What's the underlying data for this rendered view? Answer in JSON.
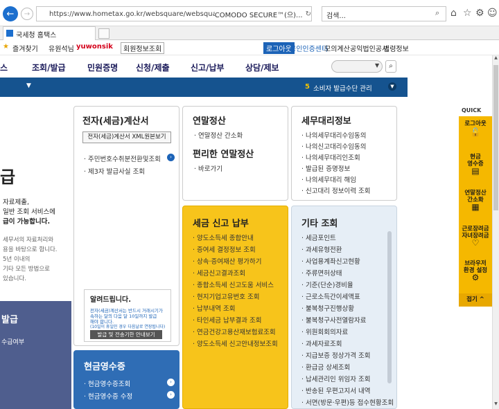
{
  "browser": {
    "url": "https://www.hometax.go.kr/websquare/websquare.wq?w2xPatl",
    "security": "COMODO SECURE™(으)...",
    "search_placeholder": "검색...",
    "tab_title": "국세청 홈택스"
  },
  "favbar": {
    "favorites": "즐겨찾기",
    "tab": "유원석님",
    "user": "yuwonsik",
    "member": "회원정보조회",
    "logout": "로그아웃",
    "cert": "공인인증센터",
    "links": [
      "모의계산",
      "공익법인공시",
      "법령정보"
    ]
  },
  "nav": {
    "items": [
      "스",
      "조회/발급",
      "민원증명",
      "신청/제출",
      "신고/납부",
      "상담/제보"
    ]
  },
  "banner": {
    "num": "5",
    "text": "소비자 발급수단 관리"
  },
  "left": {
    "big": "급",
    "lines": [
      "자료제출,",
      "일반 조회 서비스에",
      "급이 가능합니다.",
      "세무서의 자료처리와",
      "용을 바탕으로 합니다.",
      "5년 이내의",
      "기타 모든 방법으로",
      "있습니다."
    ],
    "dark_title": "발급",
    "dark_sub": "수급여부"
  },
  "card1": {
    "title": "전자(세금)계산서",
    "button": "전자(세금)계산서 XML원본보기",
    "items": [
      "주민번호수취분전환및조회",
      "제3자 발급사실 조회"
    ],
    "notice_title": "알려드립니다.",
    "notice_text": [
      "전자(세금)계산서는 반드시 거래시기가",
      "속하는 달의 다음 달 10일까지 발급",
      "해야 합니다.",
      "(10일이 휴일인 경우 다음날로 연장됩니다)"
    ],
    "notice_btn": "발급 및 전송기한 안내보기"
  },
  "card2": {
    "title": "연말정산",
    "items": [
      "연말정산 간소화"
    ],
    "title2": "편리한 연말정산",
    "items2": [
      "바로가기"
    ]
  },
  "card3": {
    "title": "세무대리정보",
    "items": [
      "나의세무대리수임동의",
      "나의신고대리수임동의",
      "나의세무대리인조회",
      "발급된 증명정보",
      "나의세무대리 해임",
      "신고대리 정보이력 조회"
    ]
  },
  "card4": {
    "title": "세금 신고 납부",
    "items": [
      "양도소득세 종합안내",
      "증여세 결정정보 조회",
      "상속·증여재산 평가하기",
      "세금신고결과조회",
      "종합소득세 신고도움 서비스",
      "현지기업고유번호 조회",
      "납부내역 조회",
      "타인세금 납부결과 조회",
      "연금건강고용산재보험료조회",
      "양도소득세 신고안내정보조회"
    ]
  },
  "card5": {
    "title": "기타 조회",
    "items": [
      "세금포인트",
      "과세유형전환",
      "사업용계좌신고현황",
      "주류면허상태",
      "기준(단순)경비율",
      "근로소득간이세액표",
      "불복청구진행상황",
      "불복청구사전열람자료",
      "위원회회의자료",
      "과세자료조회",
      "지급보증 정상가격 조회",
      "환급금 상세조회",
      "납세관리인 위임자 조회",
      "반송된 우편고지서 내역",
      "서면(방문·우편)등 접수현황조회"
    ]
  },
  "card6": {
    "title": "현금영수증",
    "items": [
      "현금영수증조회",
      "현금영수증 수정"
    ]
  },
  "quick": {
    "label": "QUICK",
    "items": [
      "로그아웃",
      "현금\n영수증",
      "연말정산\n간소화",
      "근로장려금\n자녀장려금",
      "브라우저\n환경 설정"
    ],
    "close": "접기"
  },
  "colors": {
    "primary": "#15538f",
    "yellow": "#f7c41b",
    "lightblue": "#e6eef6",
    "quick": "#f5b800"
  }
}
